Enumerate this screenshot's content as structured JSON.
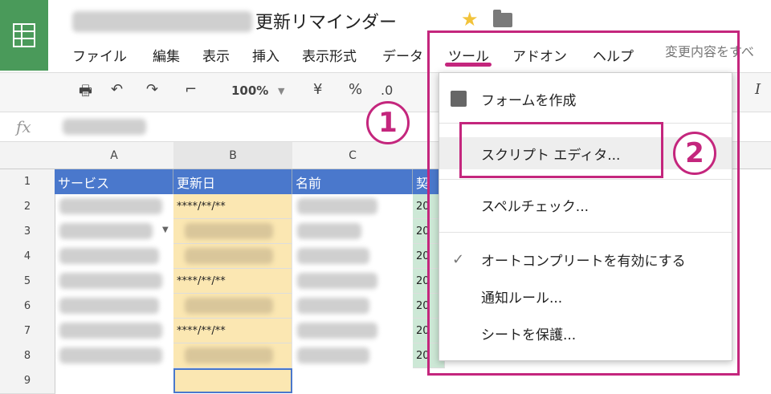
{
  "doc": {
    "title_visible": "更新リマインダー"
  },
  "menu": {
    "file": "ファイル",
    "edit": "編集",
    "view": "表示",
    "insert": "挿入",
    "format": "表示形式",
    "data": "データ",
    "tools": "ツール",
    "addons": "アドオン",
    "help": "ヘルプ",
    "changes": "変更内容をすべ"
  },
  "toolbar": {
    "zoom": "100%",
    "currency": "¥",
    "percent": "%",
    "decimal": ".0"
  },
  "columns": [
    "A",
    "B",
    "C"
  ],
  "rows": [
    "1",
    "2",
    "3",
    "4",
    "5",
    "6",
    "7",
    "8",
    "9"
  ],
  "header_row": {
    "a": "サービス",
    "b": "更新日",
    "c": "名前",
    "d": "契"
  },
  "dates": {
    "r2": "****/**/**",
    "r5": "****/**/**",
    "r7": "****/**/**"
  },
  "col_d": {
    "r2": "20",
    "r3": "20",
    "r4": "20",
    "r5": "20",
    "r6": "20",
    "r7": "20",
    "r8": "20"
  },
  "tools_menu": {
    "create_form": "フォームを作成",
    "script_editor": "スクリプト エディタ...",
    "spell_check": "スペルチェック...",
    "autocomplete": "オートコンプリートを有効にする",
    "notification_rules": "通知ルール...",
    "protect_sheet": "シートを保護..."
  },
  "annotations": {
    "step1": "1",
    "step2": "2"
  },
  "colors": {
    "accent": "#c4267d",
    "header_blue": "#4a78cc",
    "logo_green": "#4a9a5a"
  }
}
